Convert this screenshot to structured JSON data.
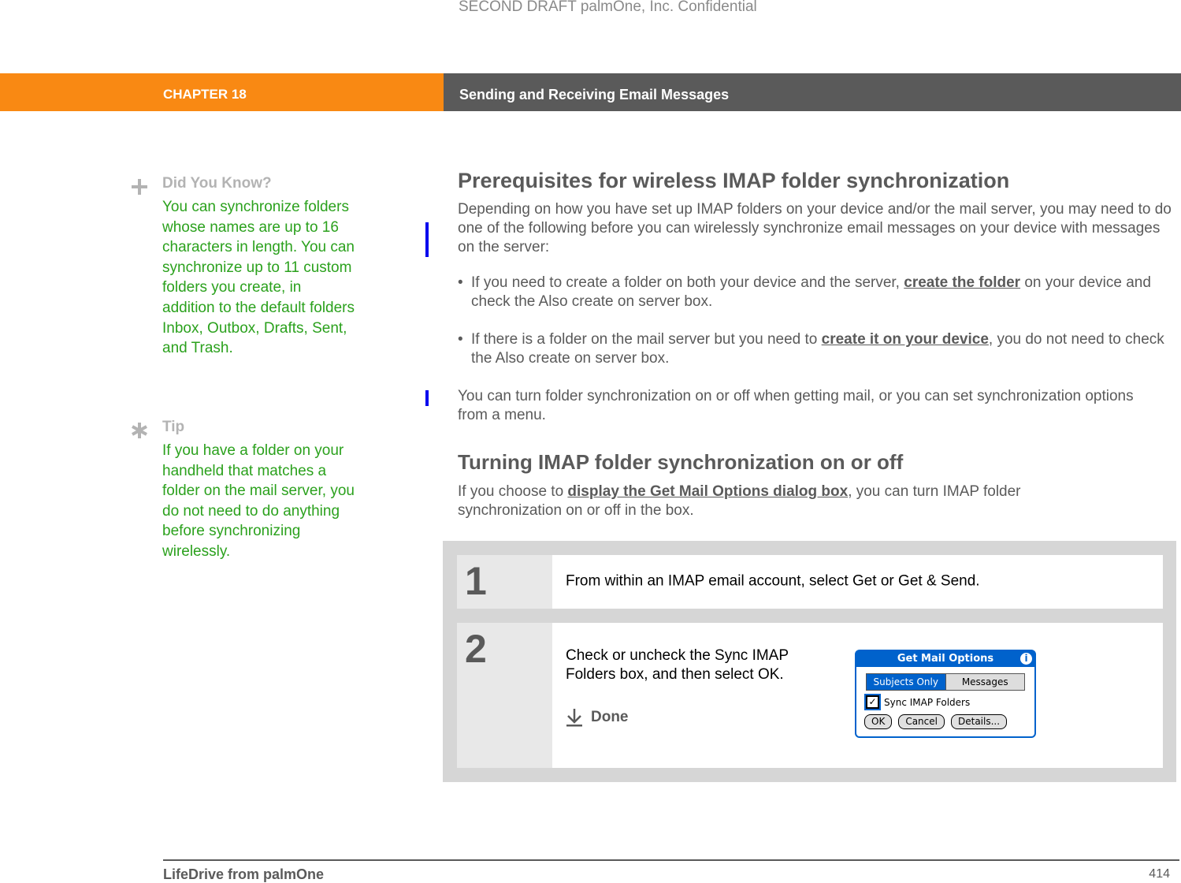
{
  "watermark": "SECOND DRAFT palmOne, Inc.  Confidential",
  "header": {
    "chapter": "CHAPTER 18",
    "title": "Sending and Receiving Email Messages",
    "colors": {
      "chapter_bg": "#f98913",
      "title_bg": "#5a5a5a"
    }
  },
  "sidebar": {
    "did_you_know": {
      "icon": "plus-icon",
      "title": "Did You Know?",
      "text": "You can synchronize folders whose names are up to 16 characters in length. You can synchronize up to 11 custom folders you create, in addition to the default folders Inbox, Outbox, Drafts, Sent, and Trash."
    },
    "tip": {
      "icon": "asterisk-icon",
      "title": "Tip",
      "text": "If you have a folder on your handheld that matches a folder on the mail server, you do not need to do anything before synchronizing wirelessly."
    },
    "text_color": "#2ba11d"
  },
  "main": {
    "section1": {
      "heading": "Prerequisites for wireless IMAP folder synchronization",
      "intro": "Depending on how you have set up IMAP folders on your device and/or the mail server, you may need to do one of the following before you can wirelessly synchronize email messages on your device with messages on the server:",
      "bullets": [
        {
          "before": "If you need to create a folder on both your device and the server, ",
          "link": "create the folder",
          "after": " on your device and check the Also create on server box."
        },
        {
          "before": "If there is a folder on the mail server but you need to ",
          "link": "create it on your device",
          "after": ", you do not need to check the Also create on server box."
        }
      ],
      "closing": "You can turn folder synchronization on or off when getting mail, or you can set synchronization options from a menu."
    },
    "section2": {
      "heading": "Turning IMAP folder synchronization on or off",
      "intro_before": "If you choose to ",
      "intro_link": "display the Get Mail Options dialog box",
      "intro_after": ", you can turn IMAP folder synchronization on or off in the box."
    },
    "steps": [
      {
        "number": "1",
        "text": "From within an IMAP email account, select Get or Get & Send."
      },
      {
        "number": "2",
        "text": "Check or uncheck the Sync IMAP Folders box, and then select OK.",
        "done_label": "Done"
      }
    ],
    "dialog": {
      "title": "Get Mail Options",
      "segments": [
        "Subjects Only",
        "Messages"
      ],
      "selected_segment": "Subjects Only",
      "checkbox_label": "Sync IMAP Folders",
      "checkbox_checked": true,
      "buttons": [
        "OK",
        "Cancel",
        "Details..."
      ]
    }
  },
  "footer": {
    "book": "LifeDrive from palmOne",
    "page": "414"
  }
}
